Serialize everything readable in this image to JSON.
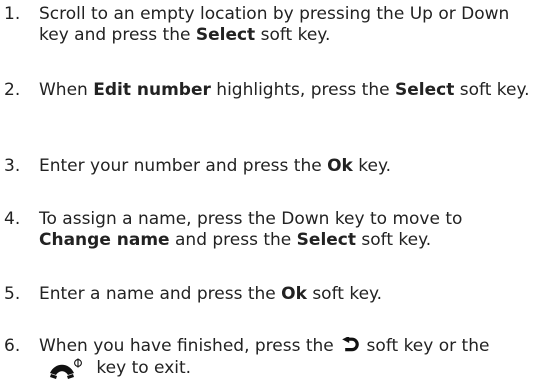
{
  "steps": [
    {
      "number": "1.",
      "parts": [
        "Scroll to an empty location by pressing the Up or Down key and press the ",
        "Select",
        " soft key."
      ]
    },
    {
      "number": "2.",
      "parts": [
        "When ",
        "Edit number",
        " highlights, press the ",
        "Select",
        " soft key."
      ]
    },
    {
      "number": "3.",
      "parts": [
        "Enter your number and press the ",
        "Ok",
        " key."
      ]
    },
    {
      "number": "4.",
      "parts": [
        "To assign a name, press the Down key to move to ",
        "Change name",
        " and press the ",
        "Select",
        " soft key."
      ]
    },
    {
      "number": "5.",
      "parts": [
        "Enter a name and press the ",
        "Ok",
        " soft key."
      ]
    },
    {
      "number": "6.",
      "parts": [
        "When you have finished, press the ",
        " soft key or the ",
        " key to exit."
      ],
      "icons": [
        "back-arrow-icon",
        "end-power-key-icon"
      ]
    }
  ]
}
